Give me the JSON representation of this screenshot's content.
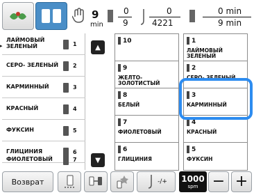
{
  "toolbar": {
    "stitch_time": {
      "value": "9",
      "unit": "min"
    },
    "color_count": {
      "current": "0",
      "total": "9"
    },
    "stitch_count": {
      "current": "0",
      "total": "4221"
    },
    "time": {
      "current": "0 min",
      "total": "9 min"
    }
  },
  "thread_list": [
    {
      "name": "ЛАЙМОВЫЙ ЗЕЛЕНЫЙ",
      "num": "1"
    },
    {
      "name": "СЕРО- ЗЕЛЕНЫЙ",
      "num": "2"
    },
    {
      "name": "КАРМИННЫЙ",
      "num": "3"
    },
    {
      "name": "КРАСНЫЙ",
      "num": "4"
    },
    {
      "name": "ФУКСИН",
      "num": "5"
    },
    {
      "name": "ГЛИЦИНИЯ",
      "num": "6"
    },
    {
      "name": "ФИОЛЕТОВЫЙ",
      "num": "7"
    }
  ],
  "grid": {
    "left_column": [
      {
        "num": "10",
        "name": ""
      },
      {
        "num": "9",
        "name": "ЖЕЛТО- ЗОЛОТИСТЫЙ"
      },
      {
        "num": "8",
        "name": "БЕЛЫЙ"
      },
      {
        "num": "7",
        "name": "ФИОЛЕТОВЫЙ"
      },
      {
        "num": "6",
        "name": "ГЛИЦИНИЯ"
      }
    ],
    "right_column": [
      {
        "num": "1",
        "name": "ЛАЙМОВЫЙ ЗЕЛЕНЫЙ"
      },
      {
        "num": "2",
        "name": "СЕРО- ЗЕЛЕНЫЙ"
      },
      {
        "num": "3",
        "name": "КАРМИННЫЙ"
      },
      {
        "num": "4",
        "name": "КРАСНЫЙ"
      },
      {
        "num": "5",
        "name": "ФУКСИН"
      }
    ]
  },
  "bottom": {
    "back_label": "Возврат",
    "speed_value": "1000",
    "speed_unit": "spm",
    "minus": "−",
    "plus": "+",
    "hook_label": "-/+"
  },
  "colors": {
    "accent": "#2d8cf0",
    "selected_toolbar": "#4a8ec7"
  }
}
